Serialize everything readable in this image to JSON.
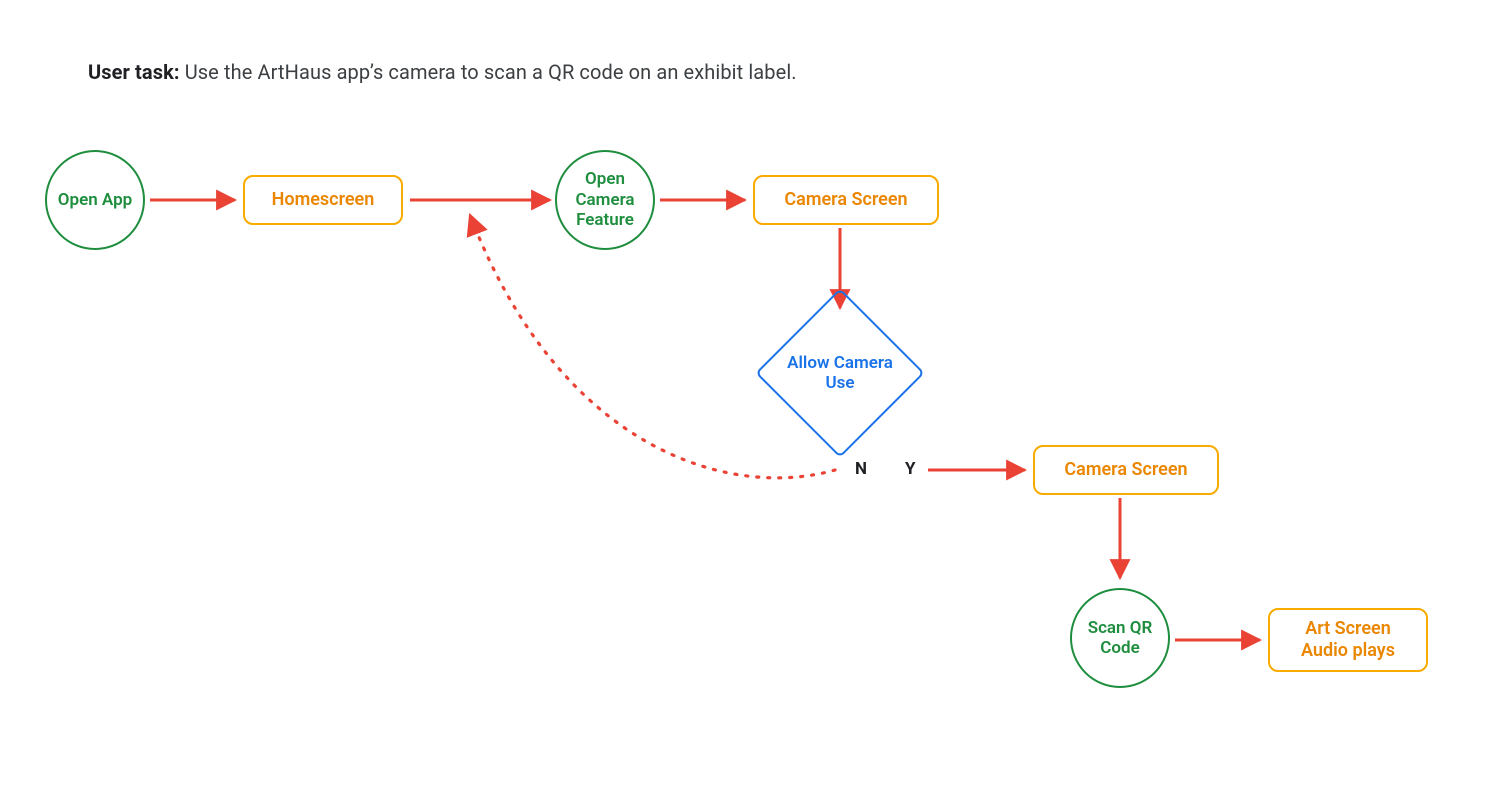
{
  "task": {
    "label": "User task:",
    "text": "Use the ArtHaus app’s camera to scan a QR code on an exhibit label."
  },
  "nodes": {
    "open_app": "Open App",
    "homescreen": "Homescreen",
    "open_camera_feature": "Open Camera Feature",
    "camera_screen_1": "Camera Screen",
    "allow_camera_use": "Allow Camera Use",
    "camera_screen_2": "Camera Screen",
    "scan_qr_code": "Scan QR Code",
    "art_screen_audio": "Art Screen Audio plays"
  },
  "branches": {
    "no": "N",
    "yes": "Y"
  },
  "colors": {
    "green": "#1e8e3e",
    "orange_border": "#f9ab00",
    "orange_text": "#ea8600",
    "blue": "#1a73e8",
    "red": "#ea4335"
  },
  "edges": [
    {
      "from": "open_app",
      "to": "homescreen",
      "style": "solid"
    },
    {
      "from": "homescreen",
      "to": "open_camera_feature",
      "style": "solid"
    },
    {
      "from": "open_camera_feature",
      "to": "camera_screen_1",
      "style": "solid"
    },
    {
      "from": "camera_screen_1",
      "to": "allow_camera_use",
      "style": "solid"
    },
    {
      "from": "allow_camera_use",
      "to": "camera_screen_2",
      "style": "solid",
      "label": "Y"
    },
    {
      "from": "allow_camera_use",
      "to": "homescreen",
      "style": "dotted",
      "label": "N"
    },
    {
      "from": "camera_screen_2",
      "to": "scan_qr_code",
      "style": "solid"
    },
    {
      "from": "scan_qr_code",
      "to": "art_screen_audio",
      "style": "solid"
    }
  ]
}
